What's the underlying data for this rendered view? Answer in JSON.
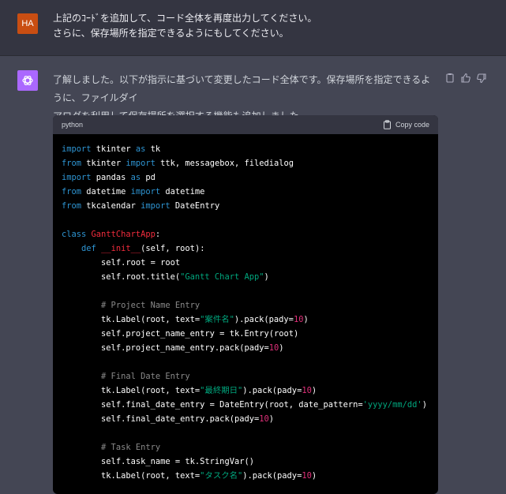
{
  "user_message": {
    "avatar_initials": "HA",
    "line1": "上記のｺｰﾄﾞを追加して、コード全体を再度出力してください。",
    "line2": "さらに、保存場所を指定できるようにもしてください。"
  },
  "assistant_message": {
    "line1": "了解しました。以下が指示に基づいて変更したコード全体です。保存場所を指定できるように、ファイルダイ",
    "line2": "アログを利用して保存場所を選択する機能も追加しました。",
    "actions": [
      "copy-icon",
      "thumbs-up-icon",
      "thumbs-down-icon"
    ]
  },
  "code_block": {
    "language": "python",
    "copy_label": "Copy code",
    "lines": [
      [
        [
          "kw",
          "import"
        ],
        [
          "p",
          " tkinter "
        ],
        [
          "kw",
          "as"
        ],
        [
          "p",
          " tk"
        ]
      ],
      [
        [
          "kw",
          "from"
        ],
        [
          "p",
          " tkinter "
        ],
        [
          "kw",
          "import"
        ],
        [
          "p",
          " ttk, messagebox, filedialog"
        ]
      ],
      [
        [
          "kw",
          "import"
        ],
        [
          "p",
          " pandas "
        ],
        [
          "kw",
          "as"
        ],
        [
          "p",
          " pd"
        ]
      ],
      [
        [
          "kw",
          "from"
        ],
        [
          "p",
          " datetime "
        ],
        [
          "kw",
          "import"
        ],
        [
          "p",
          " datetime"
        ]
      ],
      [
        [
          "kw",
          "from"
        ],
        [
          "p",
          " tkcalendar "
        ],
        [
          "kw",
          "import"
        ],
        [
          "p",
          " DateEntry"
        ]
      ],
      [],
      [
        [
          "kw",
          "class"
        ],
        [
          "p",
          " "
        ],
        [
          "cls",
          "GanttChartApp"
        ],
        [
          "p",
          ":"
        ]
      ],
      [
        [
          "p",
          "    "
        ],
        [
          "kw",
          "def"
        ],
        [
          "p",
          " "
        ],
        [
          "cls",
          "__init__"
        ],
        [
          "p",
          "(self, root):"
        ]
      ],
      [
        [
          "p",
          "        self.root = root"
        ]
      ],
      [
        [
          "p",
          "        self.root.title("
        ],
        [
          "str",
          "\"Gantt Chart App\""
        ],
        [
          "p",
          ")"
        ]
      ],
      [],
      [
        [
          "p",
          "        "
        ],
        [
          "cmt",
          "# Project Name Entry"
        ]
      ],
      [
        [
          "p",
          "        tk.Label(root, text="
        ],
        [
          "str",
          "\"案件名\""
        ],
        [
          "p",
          ").pack(pady="
        ],
        [
          "num",
          "10"
        ],
        [
          "p",
          ")"
        ]
      ],
      [
        [
          "p",
          "        self.project_name_entry = tk.Entry(root)"
        ]
      ],
      [
        [
          "p",
          "        self.project_name_entry.pack(pady="
        ],
        [
          "num",
          "10"
        ],
        [
          "p",
          ")"
        ]
      ],
      [],
      [
        [
          "p",
          "        "
        ],
        [
          "cmt",
          "# Final Date Entry"
        ]
      ],
      [
        [
          "p",
          "        tk.Label(root, text="
        ],
        [
          "str",
          "\"最終期日\""
        ],
        [
          "p",
          ").pack(pady="
        ],
        [
          "num",
          "10"
        ],
        [
          "p",
          ")"
        ]
      ],
      [
        [
          "p",
          "        self.final_date_entry = DateEntry(root, date_pattern="
        ],
        [
          "str",
          "'yyyy/mm/dd'"
        ],
        [
          "p",
          ")"
        ]
      ],
      [
        [
          "p",
          "        self.final_date_entry.pack(pady="
        ],
        [
          "num",
          "10"
        ],
        [
          "p",
          ")"
        ]
      ],
      [],
      [
        [
          "p",
          "        "
        ],
        [
          "cmt",
          "# Task Entry"
        ]
      ],
      [
        [
          "p",
          "        self.task_name = tk.StringVar()"
        ]
      ],
      [
        [
          "p",
          "        tk.Label(root, text="
        ],
        [
          "str",
          "\"タスク名\""
        ],
        [
          "p",
          ").pack(pady="
        ],
        [
          "num",
          "10"
        ],
        [
          "p",
          ")"
        ]
      ]
    ]
  },
  "colors": {
    "user_bg": "#343541",
    "assistant_bg": "#444654",
    "user_avatar": "#c94e12",
    "bot_avatar": "#ab68ff",
    "code_bg": "#000000",
    "keyword": "#2e95d3",
    "class_name": "#f22c3d",
    "string": "#00a67d",
    "number": "#df3079",
    "comment": "#8a8a8a"
  }
}
